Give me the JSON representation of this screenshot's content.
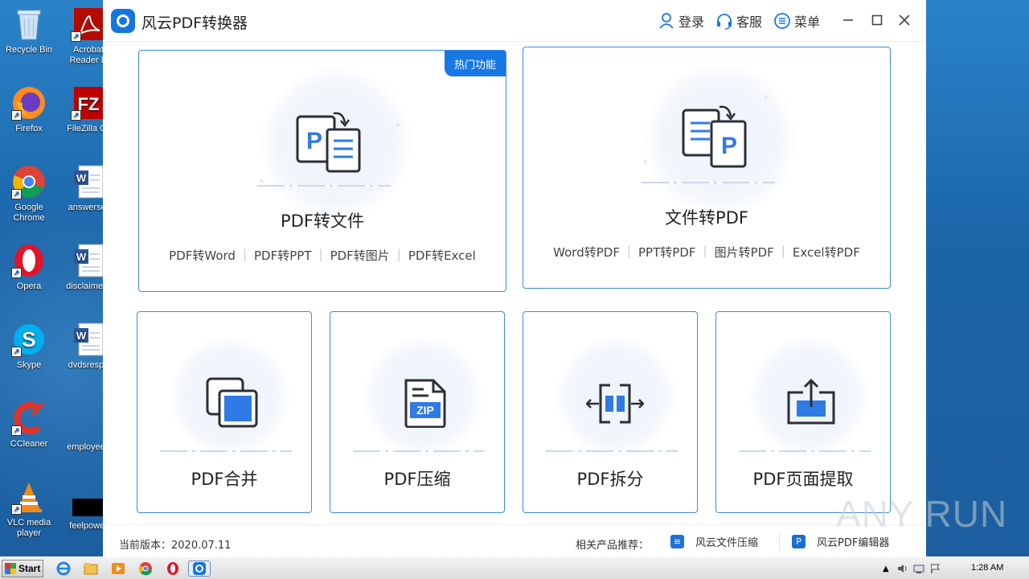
{
  "desktop": {
    "icons": [
      {
        "label": "Recycle Bin"
      },
      {
        "label": "Acrobat Reader D"
      },
      {
        "label": "Firefox"
      },
      {
        "label": "FileZilla Cli"
      },
      {
        "label": "Google Chrome"
      },
      {
        "label": "answerser"
      },
      {
        "label": "Opera"
      },
      {
        "label": "disclaimern"
      },
      {
        "label": "Skype"
      },
      {
        "label": "dvdsrespe"
      },
      {
        "label": "CCleaner"
      },
      {
        "label": "employeep"
      },
      {
        "label": "VLC media player"
      },
      {
        "label": "feelpower"
      }
    ]
  },
  "app": {
    "title": "风云PDF转换器",
    "titlebar": {
      "login": "登录",
      "service": "客服",
      "menu": "菜单"
    },
    "cards": {
      "pdf_to_file": {
        "badge": "热门功能",
        "title": "PDF转文件",
        "links": [
          "PDF转Word",
          "PDF转PPT",
          "PDF转图片",
          "PDF转Excel"
        ]
      },
      "file_to_pdf": {
        "title": "文件转PDF",
        "links": [
          "Word转PDF",
          "PPT转PDF",
          "图片转PDF",
          "Excel转PDF"
        ]
      },
      "merge": {
        "title": "PDF合并"
      },
      "compress": {
        "title": "PDF压缩",
        "icon_text": "ZIP"
      },
      "split": {
        "title": "PDF拆分"
      },
      "extract": {
        "title": "PDF页面提取"
      }
    },
    "footer": {
      "version": "当前版本：2020.07.11",
      "related_label": "相关产品推荐：",
      "products": [
        "风云文件压缩",
        "风云PDF编辑器"
      ]
    }
  },
  "watermark": "ANY RUN",
  "taskbar": {
    "start": "Start",
    "clock": "1:28 AM"
  },
  "colors": {
    "accent": "#1677e5",
    "card_border": "#3f8ae6",
    "icon_dark": "#2b2f36",
    "icon_blue": "#2f7ae5"
  }
}
